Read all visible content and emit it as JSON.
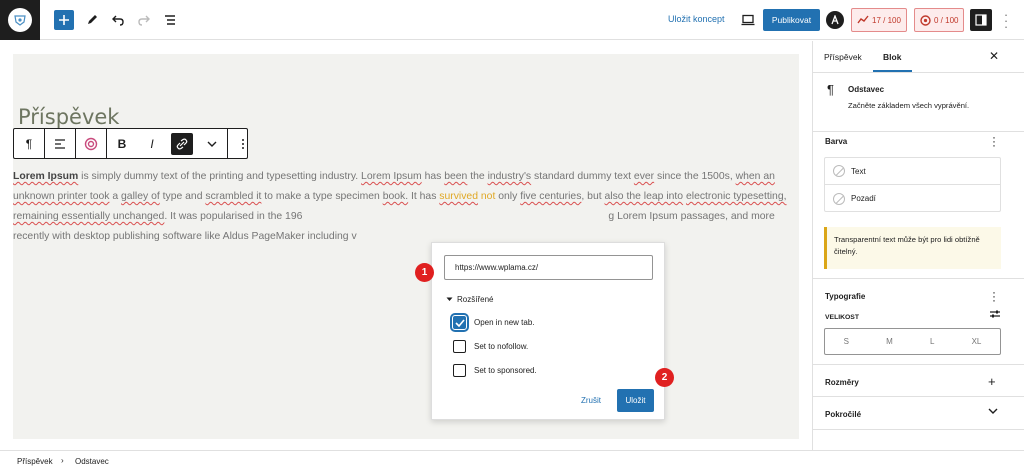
{
  "topbar": {
    "save_draft": "Uložit koncept",
    "publish": "Publikovat",
    "seo_score": "17 / 100",
    "readability_score": "0 / 100"
  },
  "editor": {
    "title": "Příspěvek",
    "paragraph": {
      "segments": [
        {
          "text": "Lorem Ipsum",
          "style": "bold-squiggle"
        },
        {
          "text": " is simply dummy text of the printing and typesetting industry. ",
          "style": "plain"
        },
        {
          "text": "Lorem Ipsum",
          "style": "squiggle"
        },
        {
          "text": " has ",
          "style": "plain"
        },
        {
          "text": "been",
          "style": "squiggle"
        },
        {
          "text": " the ",
          "style": "plain"
        },
        {
          "text": "industry's",
          "style": "squiggle"
        },
        {
          "text": " standard dummy text ",
          "style": "plain"
        },
        {
          "text": "ever",
          "style": "squiggle"
        },
        {
          "text": " since the 1500s, ",
          "style": "plain"
        },
        {
          "text": "when an unknown printer took",
          "style": "squiggle"
        },
        {
          "text": " a ",
          "style": "plain"
        },
        {
          "text": "galley of",
          "style": "squiggle"
        },
        {
          "text": " type and ",
          "style": "plain"
        },
        {
          "text": "scrambled it",
          "style": "squiggle"
        },
        {
          "text": " to make a type specimen ",
          "style": "plain"
        },
        {
          "text": "book.",
          "style": "squiggle"
        },
        {
          "text": " It has ",
          "style": "plain"
        },
        {
          "text": "survived",
          "style": "highlight-squiggle"
        },
        {
          "text": " ",
          "style": "plain"
        },
        {
          "text": "not",
          "style": "highlight"
        },
        {
          "text": " only ",
          "style": "plain"
        },
        {
          "text": "five centuries",
          "style": "squiggle"
        },
        {
          "text": ", but ",
          "style": "plain"
        },
        {
          "text": "also the leap into",
          "style": "squiggle"
        },
        {
          "text": " ",
          "style": "plain"
        },
        {
          "text": "electronic typesetting, remaining essentially unchanged",
          "style": "squiggle"
        },
        {
          "text": ". It was popularised in the 196",
          "style": "plain"
        },
        {
          "text": "g Lorem Ipsum passages,",
          "style": "plain-right"
        },
        {
          "text": " and more recently with desktop publishing software like Aldus PageMaker including v",
          "style": "plain-break"
        }
      ]
    }
  },
  "link_popover": {
    "url": "https://www.wplama.cz/",
    "advanced_label": "Rozšířené",
    "options": [
      {
        "label": "Open in new tab.",
        "checked": true
      },
      {
        "label": "Set to nofollow.",
        "checked": false
      },
      {
        "label": "Set to sponsored.",
        "checked": false
      }
    ],
    "cancel": "Zrušit",
    "save": "Uložit",
    "markers": [
      "1",
      "2"
    ]
  },
  "sidebar": {
    "tabs": [
      "Příspěvek",
      "Blok"
    ],
    "block_name": "Odstavec",
    "block_desc": "Začněte základem všech vyprávění.",
    "color_panel": "Barva",
    "color_items": [
      "Text",
      "Pozadí"
    ],
    "notice": "Transparentní text může být pro lidi obtížně čitelný.",
    "typography_panel": "Typografie",
    "size_label": "VELIKOST",
    "sizes": [
      "S",
      "M",
      "L",
      "XL"
    ],
    "dimensions_panel": "Rozměry",
    "advanced_panel": "Pokročilé"
  },
  "footer": {
    "crumbs": [
      "Příspěvek",
      "Odstavec"
    ]
  },
  "colors": {
    "accent": "#2271b1",
    "marker": "#e02020",
    "notice_border": "#dba617"
  }
}
